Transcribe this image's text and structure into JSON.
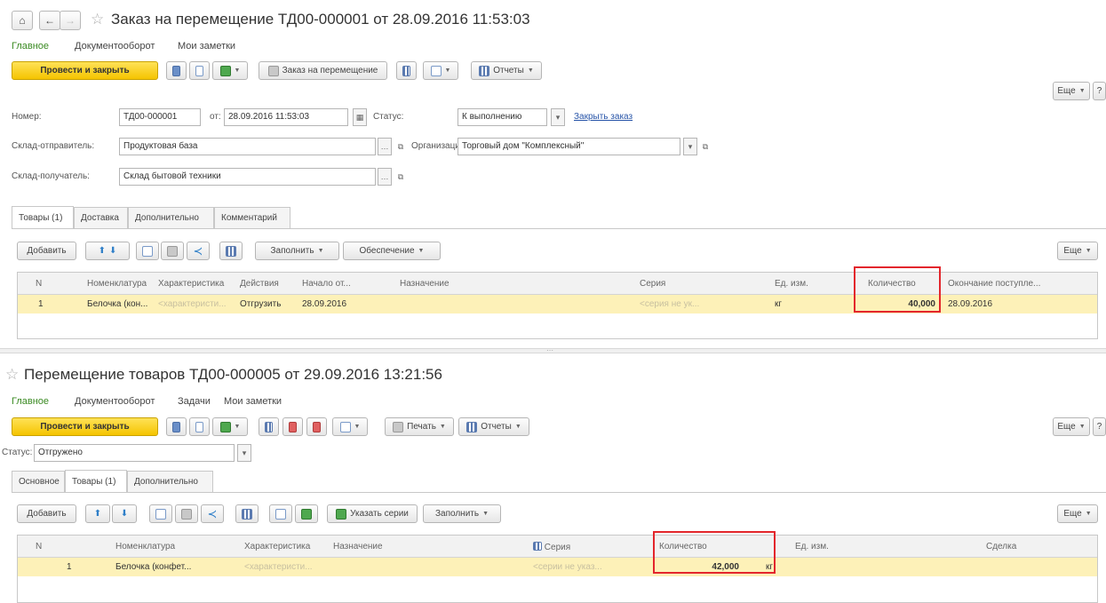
{
  "order": {
    "title": "Заказ на перемещение ТД00-000001 от 28.09.2016 11:53:03",
    "sections": [
      "Главное",
      "Документооборот",
      "Мои заметки"
    ],
    "toolbar": {
      "post_close": "Провести и закрыть",
      "create_move": "Заказ на перемещение",
      "reports": "Отчеты",
      "more": "Еще",
      "help": "?"
    },
    "fields": {
      "number_label": "Номер:",
      "number_value": "ТД00-000001",
      "date_label": "от:",
      "date_value": "28.09.2016 11:53:03",
      "status_label": "Статус:",
      "status_value": "К выполнению",
      "close_order_link": "Закрыть заказ",
      "sender_label": "Склад-отправитель:",
      "sender_value": "Продуктовая база",
      "org_label": "Организация:",
      "org_value": "Торговый дом \"Комплексный\"",
      "receiver_label": "Склад-получатель:",
      "receiver_value": "Склад бытовой техники"
    },
    "tabs": [
      "Товары (1)",
      "Доставка",
      "Дополнительно",
      "Комментарий"
    ],
    "table_toolbar": {
      "add": "Добавить",
      "fill": "Заполнить",
      "provision": "Обеспечение",
      "more": "Еще"
    },
    "columns": [
      "N",
      "Номенклатура",
      "Характеристика",
      "Действия",
      "Начало от...",
      "Назначение",
      "Серия",
      "Ед. изм.",
      "Количество",
      "Окончание поступле..."
    ],
    "rows": [
      {
        "n": "1",
        "nomenclature": "Белочка (кон...",
        "characteristic": "<характеристи...",
        "action": "Отгрузить",
        "start": "28.09.2016",
        "purpose": "",
        "series": "<серия не ук...",
        "unit": "кг",
        "quantity": "40,000",
        "end": "28.09.2016"
      }
    ]
  },
  "transfer": {
    "title": "Перемещение товаров ТД00-000005 от 29.09.2016 13:21:56",
    "sections": [
      "Главное",
      "Документооборот",
      "Задачи",
      "Мои заметки"
    ],
    "toolbar": {
      "post_close": "Провести и закрыть",
      "print": "Печать",
      "reports": "Отчеты",
      "more": "Еще",
      "help": "?"
    },
    "fields": {
      "status_label": "Статус:",
      "status_value": "Отгружено"
    },
    "tabs": [
      "Основное",
      "Товары (1)",
      "Дополнительно"
    ],
    "table_toolbar": {
      "add": "Добавить",
      "set_series": "Указать серии",
      "fill": "Заполнить",
      "more": "Еще"
    },
    "columns": [
      "N",
      "Номенклатура",
      "Характеристика",
      "Назначение",
      "Серия",
      "Количество",
      "Ед. изм.",
      "Сделка"
    ],
    "rows": [
      {
        "n": "1",
        "nomenclature": "Белочка (конфет...",
        "characteristic": "<характеристи...",
        "purpose": "",
        "series": "<серии не указ...",
        "quantity": "42,000",
        "unit": "кг",
        "deal": ""
      }
    ]
  },
  "colors": {
    "accent_yellow": "#f5c400",
    "row_highlight": "#fdf1b8",
    "highlight_box": "#e3262c",
    "active_section": "#3a8a22"
  }
}
